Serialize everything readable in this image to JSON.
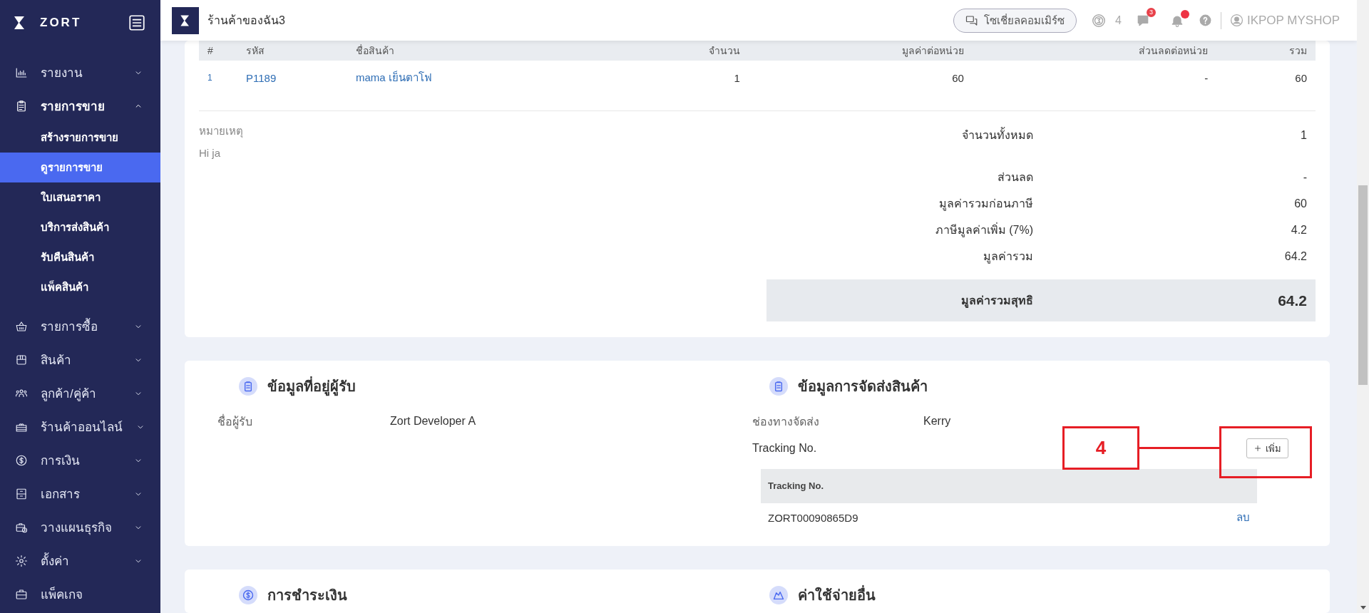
{
  "sidebar": {
    "logo": "ZORT",
    "items": [
      {
        "label": "รายงาน",
        "expandable": true,
        "expanded": false
      },
      {
        "label": "รายการขาย",
        "expandable": true,
        "expanded": true,
        "children": [
          {
            "label": "สร้างรายการขาย",
            "selected": false
          },
          {
            "label": "ดูรายการขาย",
            "selected": true
          },
          {
            "label": "ใบเสนอราคา",
            "selected": false
          },
          {
            "label": "บริการส่งสินค้า",
            "selected": false
          },
          {
            "label": "รับคืนสินค้า",
            "selected": false
          },
          {
            "label": "แพ็คสินค้า",
            "selected": false
          }
        ]
      },
      {
        "label": "รายการซื้อ",
        "expandable": true,
        "expanded": false
      },
      {
        "label": "สินค้า",
        "expandable": true,
        "expanded": false
      },
      {
        "label": "ลูกค้า/คู่ค้า",
        "expandable": true,
        "expanded": false
      },
      {
        "label": "ร้านค้าออนไลน์",
        "expandable": true,
        "expanded": false
      },
      {
        "label": "การเงิน",
        "expandable": true,
        "expanded": false
      },
      {
        "label": "เอกสาร",
        "expandable": true,
        "expanded": false
      },
      {
        "label": "วางแผนธุรกิจ",
        "expandable": true,
        "expanded": false
      },
      {
        "label": "ตั้งค่า",
        "expandable": true,
        "expanded": false
      },
      {
        "label": "แพ็คเกจ",
        "expandable": false,
        "expanded": false
      }
    ]
  },
  "topbar": {
    "shop_name": "ร้านค้าของฉัน3",
    "social_button": "โซเชี่ยลคอมเมิร์ซ",
    "coins": "4",
    "messages_badge": "3",
    "notification_dot": true,
    "user": "IKPOP MYSHOP"
  },
  "items_table": {
    "columns": [
      "#",
      "รหัส",
      "ชื่อสินค้า",
      "จำนวน",
      "มูลค่าต่อหน่วย",
      "ส่วนลดต่อหน่วย",
      "รวม"
    ],
    "rows": [
      {
        "no": "1",
        "code": "P1189",
        "name": "mama เย็นตาโฟ",
        "qty": "1",
        "unit_price": "60",
        "discount": "-",
        "total": "60"
      }
    ]
  },
  "note": {
    "label": "หมายเหตุ",
    "text": "Hi ja"
  },
  "summary": [
    {
      "label": "จำนวนทั้งหมด",
      "value": "1"
    },
    {
      "label": "ส่วนลด",
      "value": "-"
    },
    {
      "label": "มูลค่ารวมก่อนภาษี",
      "value": "60"
    },
    {
      "label": "ภาษีมูลค่าเพิ่ม (7%)",
      "value": "4.2"
    },
    {
      "label": "มูลค่ารวม",
      "value": "64.2"
    }
  ],
  "net_total": {
    "label": "มูลค่ารวมสุทธิ",
    "value": "64.2"
  },
  "recipient": {
    "title": "ข้อมูลที่อยู่ผู้รับ",
    "fields": [
      {
        "label": "ชื่อผู้รับ",
        "value": "Zort Developer A"
      }
    ]
  },
  "shipping": {
    "title": "ข้อมูลการจัดส่งสินค้า",
    "channel_label": "ช่องทางจัดส่ง",
    "channel": "Kerry",
    "tracking_label": "Tracking No.",
    "add_button": "เพิ่ม",
    "tracking_table": {
      "column": "Tracking No.",
      "rows": [
        {
          "number": "ZORT00090865D9",
          "action": "ลบ"
        }
      ]
    }
  },
  "annotation": {
    "label": "4"
  },
  "lower_sections": [
    {
      "title": "การชำระเงิน"
    },
    {
      "title": "ค่าใช้จ่ายอื่น"
    }
  ]
}
